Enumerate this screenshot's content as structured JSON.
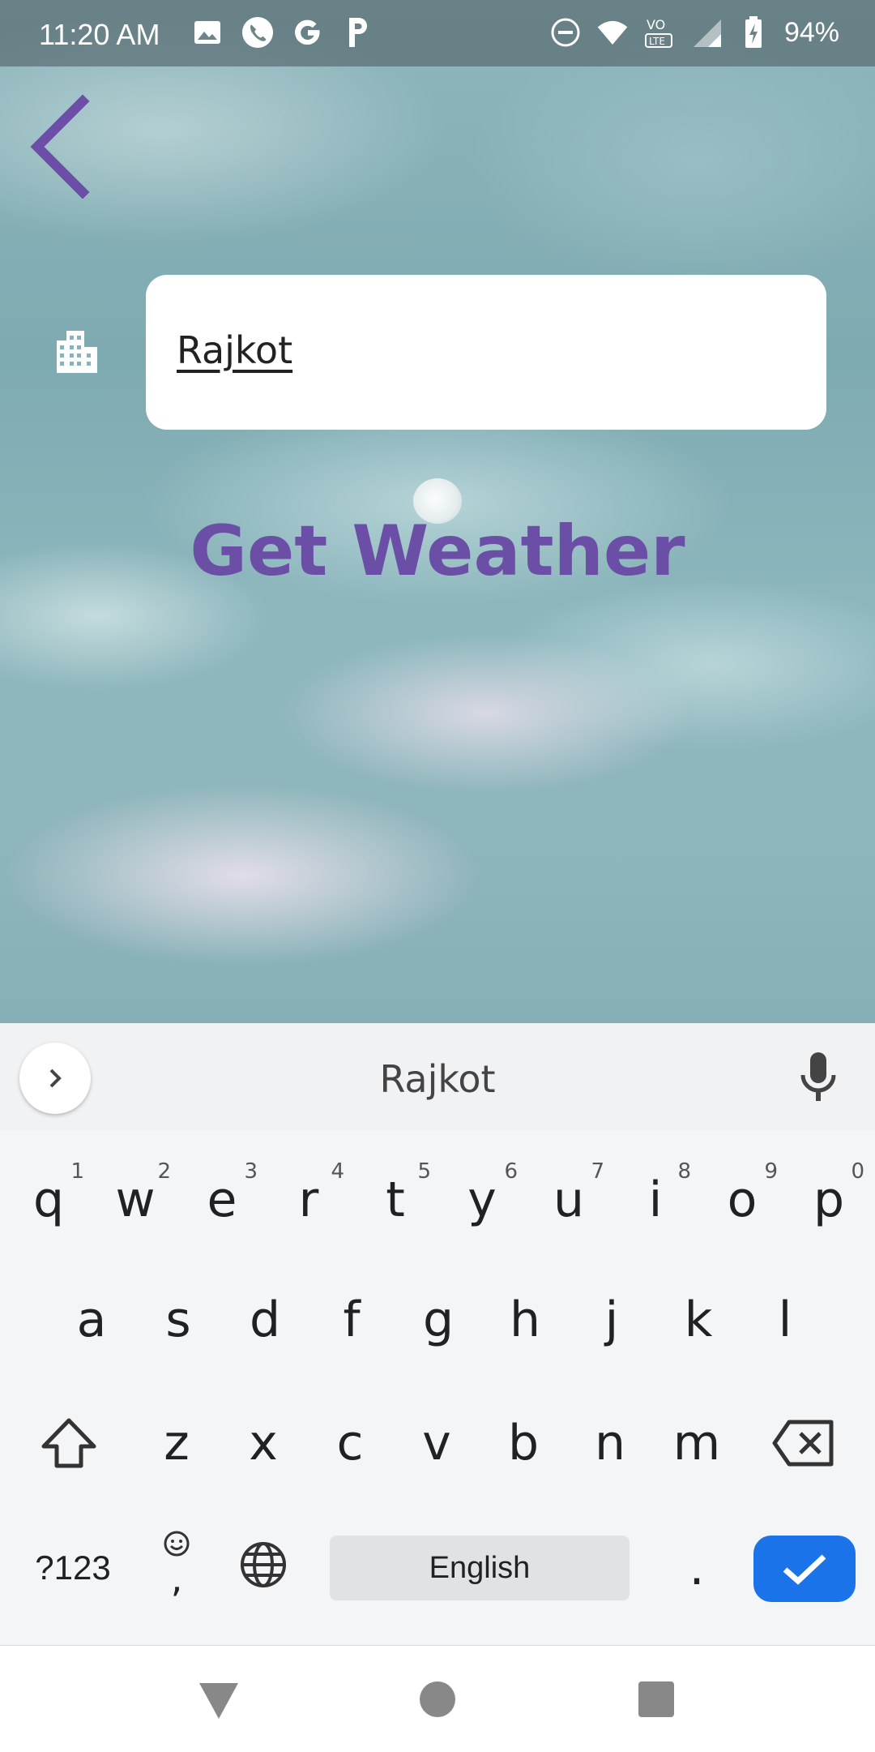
{
  "status_bar": {
    "time": "11:20 AM",
    "battery": "94%",
    "left_icons": [
      "image-icon",
      "phone-icon",
      "google-icon",
      "p-icon"
    ],
    "right_icons": [
      "dnd-icon",
      "wifi-icon",
      "volte-icon",
      "signal-icon",
      "battery-icon"
    ]
  },
  "header": {
    "back_icon": "back-arrow-icon"
  },
  "form": {
    "city_icon": "city-icon",
    "city_value": "Rajkot"
  },
  "action": {
    "get_weather_label": "Get Weather"
  },
  "colors": {
    "accent": "#6b4ea6",
    "enter_key": "#1a73e8"
  },
  "keyboard": {
    "suggestion": "Rajkot",
    "row1": [
      {
        "k": "q",
        "h": "1"
      },
      {
        "k": "w",
        "h": "2"
      },
      {
        "k": "e",
        "h": "3"
      },
      {
        "k": "r",
        "h": "4"
      },
      {
        "k": "t",
        "h": "5"
      },
      {
        "k": "y",
        "h": "6"
      },
      {
        "k": "u",
        "h": "7"
      },
      {
        "k": "i",
        "h": "8"
      },
      {
        "k": "o",
        "h": "9"
      },
      {
        "k": "p",
        "h": "0"
      }
    ],
    "row2": [
      "a",
      "s",
      "d",
      "f",
      "g",
      "h",
      "j",
      "k",
      "l"
    ],
    "row3": [
      "z",
      "x",
      "c",
      "v",
      "b",
      "n",
      "m"
    ],
    "symbols_label": "?123",
    "comma_label": ",",
    "space_label": "English",
    "period_label": "."
  }
}
